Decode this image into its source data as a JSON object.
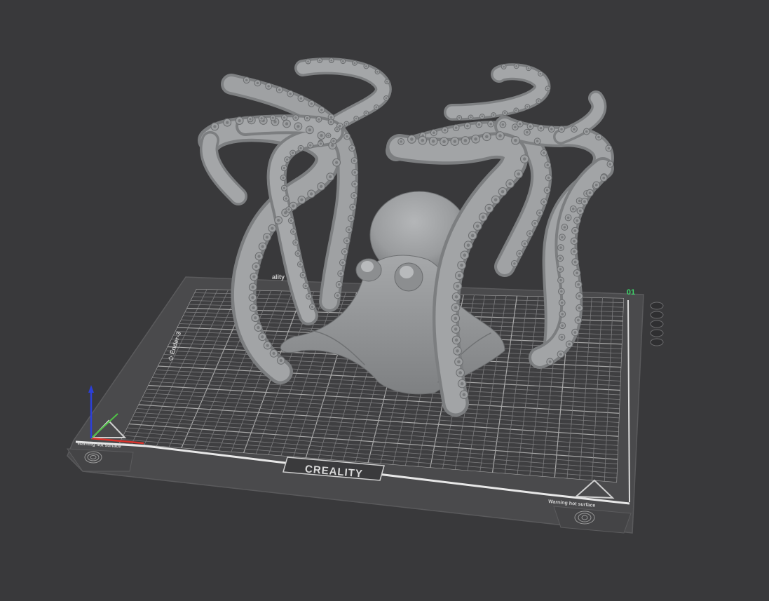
{
  "viewport": {
    "background": "#39393b"
  },
  "bed": {
    "brand": "CREALITY",
    "plate_number": "01",
    "plate_number_color": "#3fd46b",
    "warning_left": "Warning hot surface",
    "warning_right": "Warning hot surface",
    "side_label": "◇ Ender-3",
    "back_label": "ality T"
  },
  "model": {
    "name": "octopus",
    "color": "#9a9c9e"
  },
  "axes": {
    "x_color": "#d8332c",
    "y_color": "#4fc246",
    "z_color": "#2c3fd8"
  },
  "icons": {
    "hot_surface": "hot-surface-warning-icon",
    "fingerprint": "fingerprint-icon"
  }
}
